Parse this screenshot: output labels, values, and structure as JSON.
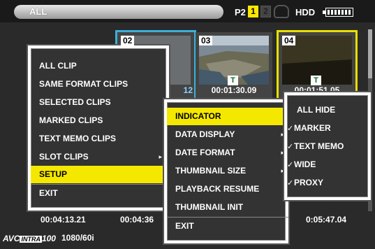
{
  "header": {
    "title": "ALL",
    "media": "P2",
    "slot_1": "1",
    "slot_2": "2",
    "hdd": "HDD"
  },
  "thumbnails": [
    {
      "number": "02",
      "timecode": "12"
    },
    {
      "number": "03",
      "timecode": "00:01:30.09",
      "text_memo_marker": "T"
    },
    {
      "number": "04",
      "timecode": "00:01:51.05",
      "text_memo_marker": "T"
    }
  ],
  "bottom_timecodes": [
    "00:04:13.21",
    "00:04:36",
    "0:05:47.04"
  ],
  "footer": {
    "codec_prefix": "AVC",
    "codec_intra": "INTRA",
    "codec_bitrate": "100",
    "format": "1080/60i"
  },
  "main_menu": {
    "items": [
      {
        "label": "ALL CLIP"
      },
      {
        "label": "SAME FORMAT CLIPS"
      },
      {
        "label": "SELECTED CLIPS"
      },
      {
        "label": "MARKED CLIPS"
      },
      {
        "label": "TEXT MEMO CLIPS"
      },
      {
        "label": "SLOT CLIPS",
        "arrow": "▸"
      },
      {
        "label": "SETUP",
        "arrow": "▸",
        "active": true
      },
      {
        "label": "EXIT"
      }
    ]
  },
  "setup_menu": {
    "items": [
      {
        "label": "INDICATOR",
        "arrow": "▸",
        "active": true
      },
      {
        "label": "DATA DISPLAY",
        "arrow": "▸"
      },
      {
        "label": "DATE FORMAT",
        "arrow": "▸"
      },
      {
        "label": "THUMBNAIL SIZE",
        "arrow": "▸"
      },
      {
        "label": "PLAYBACK RESUME"
      },
      {
        "label": "THUMBNAIL INIT"
      },
      {
        "label": "EXIT"
      }
    ]
  },
  "indicator_menu": {
    "items": [
      {
        "label": "ALL HIDE",
        "checked": false
      },
      {
        "label": "MARKER",
        "checked": true
      },
      {
        "label": "TEXT MEMO",
        "checked": true
      },
      {
        "label": "WIDE",
        "checked": true
      },
      {
        "label": "PROXY",
        "checked": true
      }
    ],
    "check_glyph": "✓"
  },
  "colors": {
    "highlight": "#f5e800",
    "selection_blue": "#3ab0d8",
    "selection_yellow": "#e8e000"
  }
}
